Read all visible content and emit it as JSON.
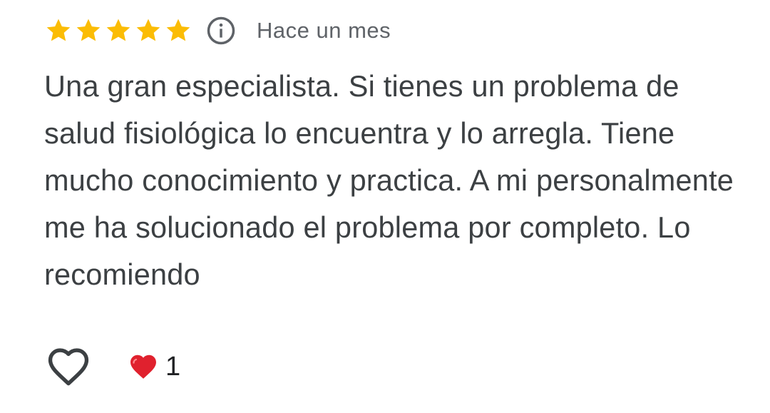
{
  "review": {
    "rating": 5,
    "max_rating": 5,
    "time_ago": "Hace un mes",
    "text": "Una gran especialista. Si tienes un problema de salud fisiológica lo encuentra y lo arregla. Tiene mucho conocimiento y practica. A mi personalmente me ha solucionado el problema por completo. Lo recomiendo",
    "reaction_count": "1"
  },
  "icons": {
    "rating": "star-icon",
    "info": "info-icon",
    "like": "heart-outline-icon",
    "reaction": "red-heart-icon"
  },
  "colors": {
    "star": "#fbbc04",
    "text": "#3c4043",
    "muted": "#5f6368",
    "heart": "#e0212e"
  }
}
